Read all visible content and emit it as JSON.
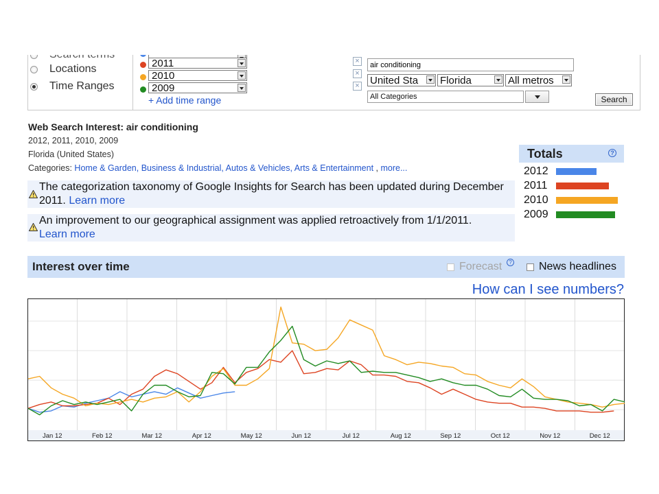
{
  "compare_by": [
    {
      "label": "Search terms",
      "checked": false
    },
    {
      "label": "Locations",
      "checked": false
    },
    {
      "label": "Time Ranges",
      "checked": true
    }
  ],
  "time_ranges": [
    {
      "year": "2011",
      "color": "#dd4422"
    },
    {
      "year": "2010",
      "color": "#f5a623"
    },
    {
      "year": "2009",
      "color": "#228b22"
    }
  ],
  "add_time_range": "+  Add time range",
  "query": {
    "term": "air conditioning",
    "remove_icon": "x-icon",
    "country": "United Sta",
    "region": "Florida",
    "metro": "All metros",
    "category": "All Categories",
    "search_label": "Search"
  },
  "info": {
    "title": "Web Search Interest: air conditioning",
    "years": "2012, 2011, 2010, 2009",
    "location": "Florida (United States)",
    "categories_prefix": "Categories:",
    "categories": "Home & Garden, Business & Industrial, Autos & Vehicles, Arts & Entertainment",
    "more": "more..."
  },
  "notices": [
    {
      "text": "The categorization taxonomy of Google Insights for Search has been updated during December 2011.",
      "link": "Learn more"
    },
    {
      "text": "An improvement to our geographical assignment was applied retroactively from 1/1/2011.",
      "link": "Learn more"
    }
  ],
  "totals": {
    "title": "Totals",
    "help": "?",
    "rows": [
      {
        "label": "2012",
        "color": "#4a86e8",
        "value": 0.65
      },
      {
        "label": "2011",
        "color": "#dd4422",
        "value": 0.85
      },
      {
        "label": "2010",
        "color": "#f5a623",
        "value": 1.0
      },
      {
        "label": "2009",
        "color": "#228b22",
        "value": 0.95
      }
    ]
  },
  "interest_over_time": {
    "title": "Interest over time",
    "forecast_label": "Forecast",
    "forecast_enabled": false,
    "help": "?",
    "news_label": "News headlines",
    "news_checked": false,
    "how_link": "How can I see numbers?"
  },
  "chart_data": {
    "type": "line",
    "x": [
      "Jan 12",
      "Feb 12",
      "Mar 12",
      "Apr 12",
      "May 12",
      "Jun 12",
      "Jul 12",
      "Aug 12",
      "Sep 12",
      "Oct 12",
      "Nov 12",
      "Dec 12"
    ],
    "ylim": [
      0,
      100
    ],
    "grid": true,
    "series": [
      {
        "name": "2012",
        "color": "#4a86e8",
        "values": [
          17,
          14,
          15,
          19,
          18,
          21,
          23,
          25,
          30,
          26,
          28,
          30,
          28,
          33,
          29,
          25,
          27,
          29,
          30
        ]
      },
      {
        "name": "2011",
        "color": "#dd4422",
        "values": [
          17,
          20,
          22,
          19,
          19,
          20,
          21,
          25,
          20,
          28,
          32,
          42,
          47,
          44,
          38,
          32,
          37,
          49,
          37,
          45,
          48,
          55,
          53,
          62,
          44,
          45,
          48,
          47,
          54,
          51,
          43,
          43,
          42,
          38,
          37,
          33,
          28,
          32,
          28,
          24,
          22,
          21,
          21,
          18,
          18,
          17,
          15,
          15,
          15,
          14,
          14,
          15
        ]
      },
      {
        "name": "2010",
        "color": "#f5a623",
        "values": [
          40,
          42,
          33,
          28,
          25,
          19,
          21,
          20,
          22,
          24,
          22,
          25,
          26,
          30,
          22,
          30,
          42,
          48,
          35,
          35,
          40,
          48,
          96,
          68,
          67,
          62,
          63,
          72,
          86,
          82,
          78,
          58,
          55,
          51,
          53,
          52,
          50,
          49,
          44,
          43,
          38,
          35,
          33,
          40,
          34,
          26,
          24,
          22,
          21,
          20,
          18,
          20,
          21,
          18,
          17,
          13,
          12,
          12
        ]
      },
      {
        "name": "2009",
        "color": "#228b22",
        "values": [
          17,
          12,
          19,
          23,
          20,
          22,
          20,
          22,
          24,
          15,
          28,
          35,
          35,
          30,
          26,
          27,
          45,
          44,
          36,
          49,
          49,
          61,
          70,
          81,
          55,
          50,
          54,
          52,
          54,
          45,
          46,
          45,
          45,
          43,
          41,
          38,
          40,
          37,
          35,
          35,
          32,
          27,
          26,
          32,
          25,
          24,
          24,
          23,
          19,
          20,
          15,
          24,
          22,
          24,
          17,
          31
        ]
      }
    ]
  }
}
